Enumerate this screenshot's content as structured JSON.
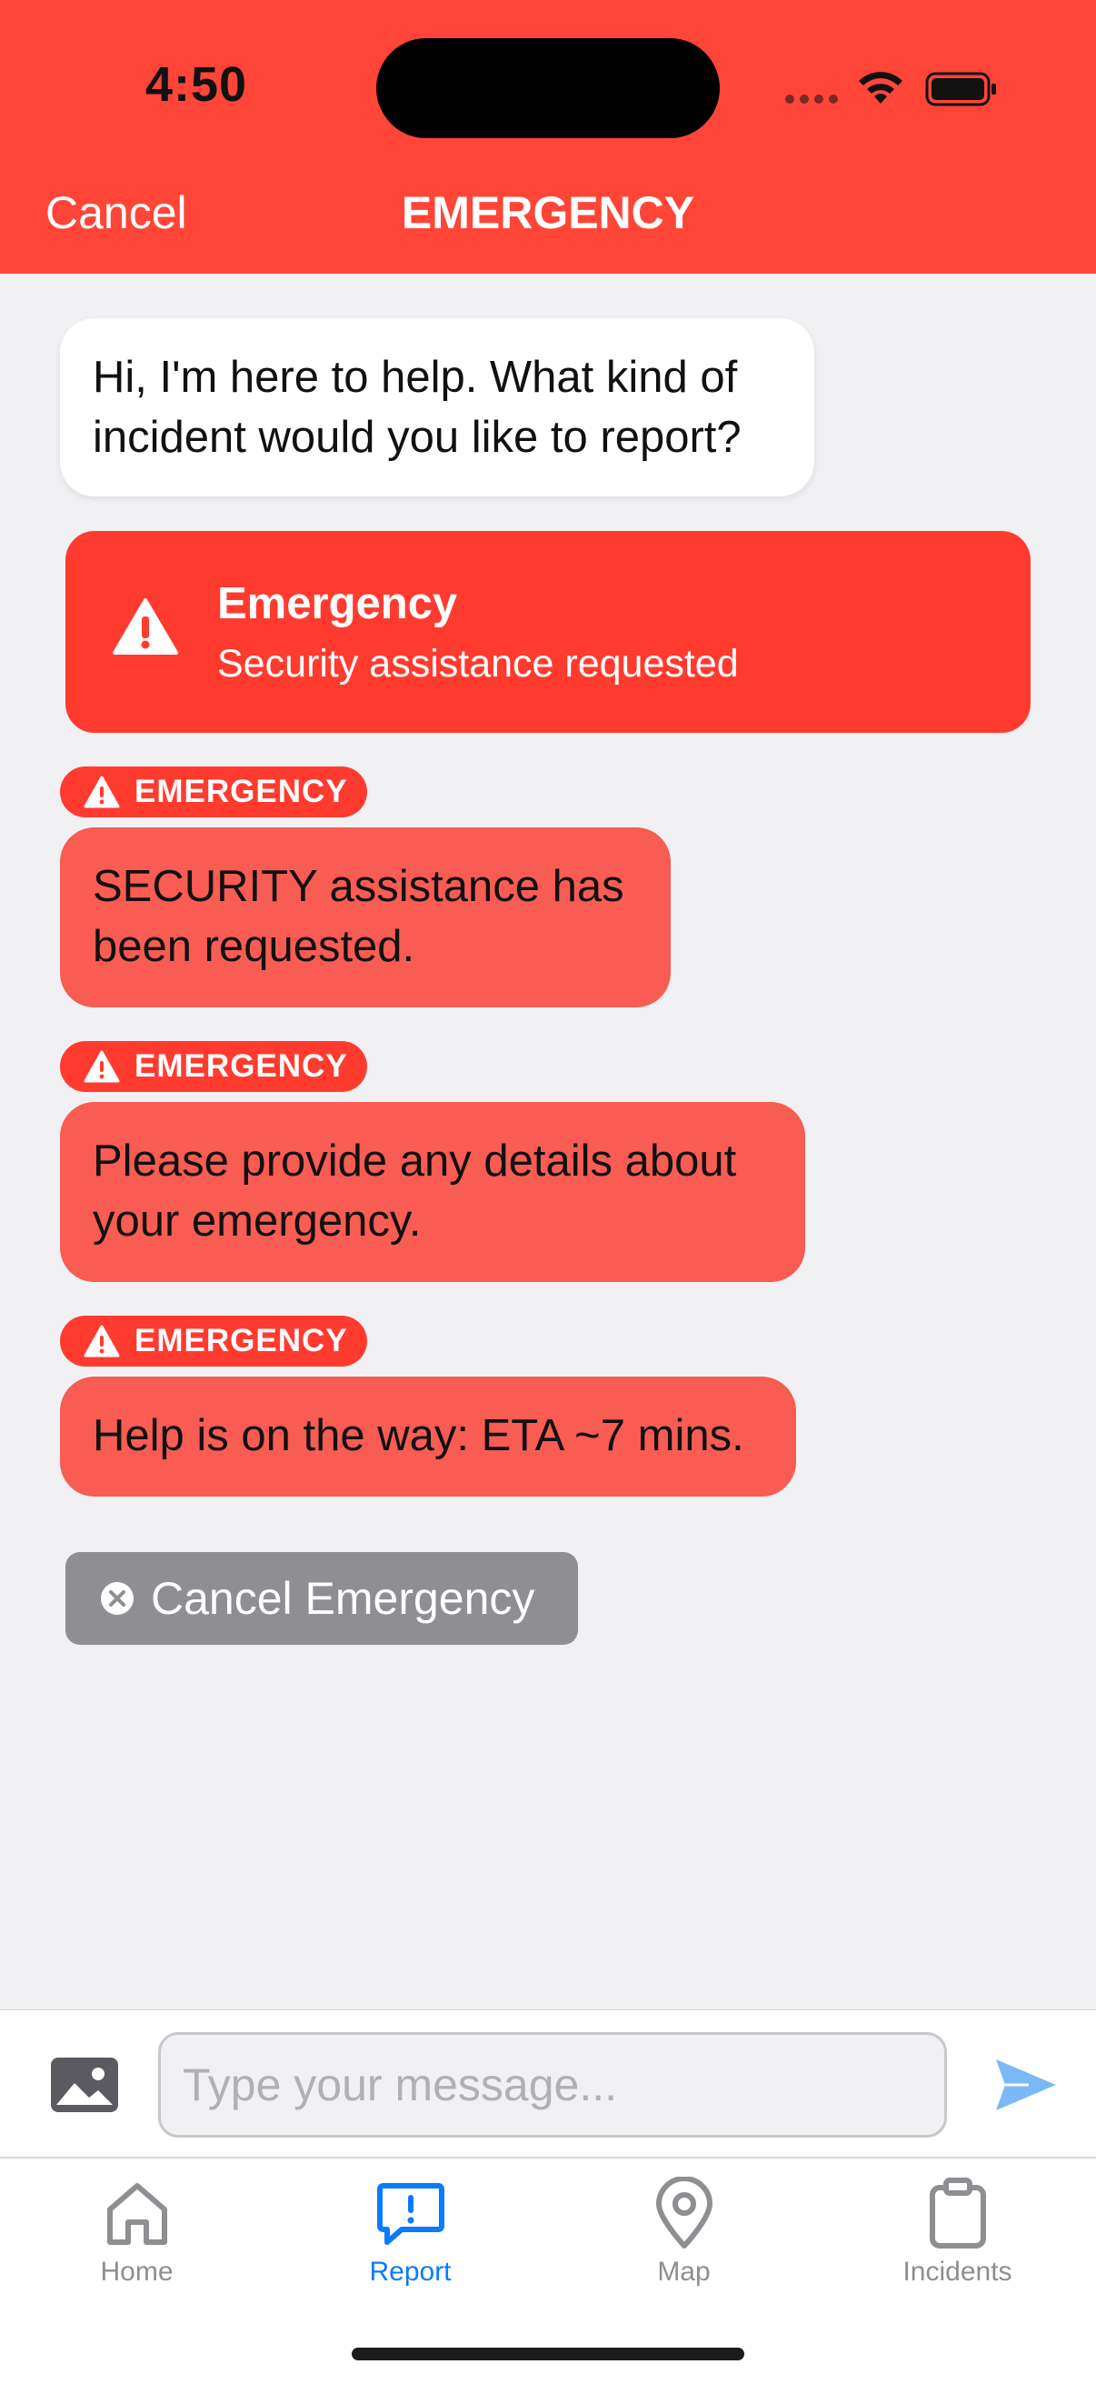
{
  "status_bar": {
    "time": "4:50"
  },
  "nav": {
    "cancel_label": "Cancel",
    "title": "EMERGENCY"
  },
  "colors": {
    "accent_red": "#ff3b30",
    "header_red": "#ff4538",
    "bubble_red": "#f85c52",
    "link_blue": "#0a7aff",
    "muted_gray": "#8e8e93"
  },
  "messages": [
    {
      "type": "assistant",
      "text": "Hi, I'm here to help. What kind of incident would you like to report?"
    },
    {
      "type": "alert-card",
      "icon": "warning-icon",
      "title": "Emergency",
      "subtitle": "Security assistance requested"
    },
    {
      "type": "emergency",
      "badge": "EMERGENCY",
      "text": "SECURITY assistance has been requested."
    },
    {
      "type": "emergency",
      "badge": "EMERGENCY",
      "text": "Please provide any details about your emergency."
    },
    {
      "type": "emergency",
      "badge": "EMERGENCY",
      "text": "Help is on the way: ETA ~7 mins."
    }
  ],
  "cancel_emergency_label": "Cancel Emergency",
  "composer": {
    "placeholder": "Type your message...",
    "photo_icon": "photo-icon",
    "send_icon": "send-icon"
  },
  "tabs": [
    {
      "label": "Home",
      "icon": "home-icon",
      "active": false
    },
    {
      "label": "Report",
      "icon": "report-icon",
      "active": true
    },
    {
      "label": "Map",
      "icon": "map-pin-icon",
      "active": false
    },
    {
      "label": "Incidents",
      "icon": "clipboard-icon",
      "active": false
    }
  ]
}
